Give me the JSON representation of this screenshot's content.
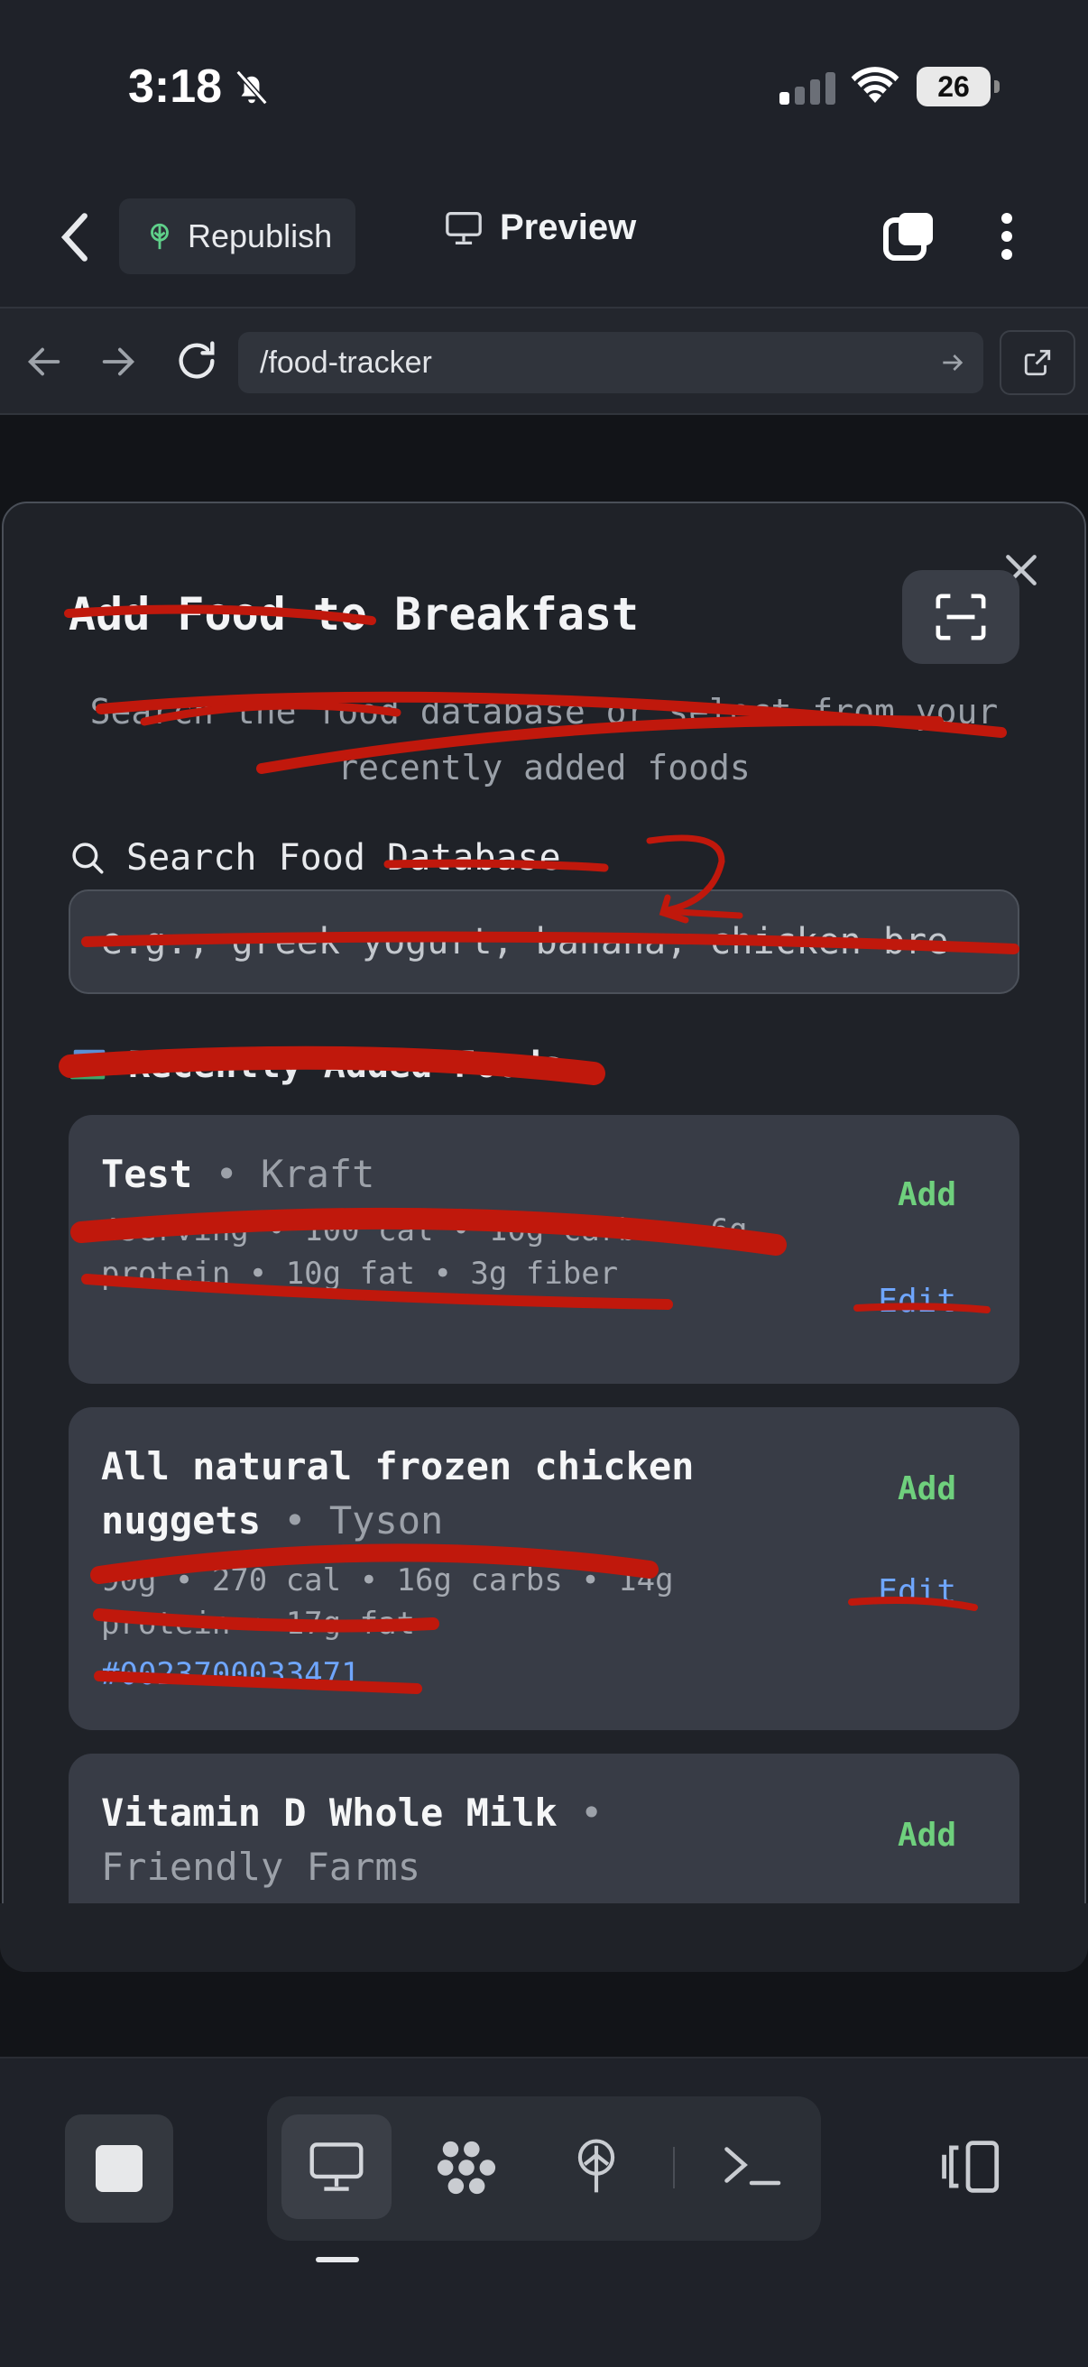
{
  "status_bar": {
    "time": "3:18",
    "battery": "26"
  },
  "toolbar": {
    "republish_label": "Republish",
    "preview_label": "Preview"
  },
  "address_bar": {
    "url": "/food-tracker"
  },
  "modal": {
    "title": "Add Food to Breakfast",
    "subtitle": "Search the food database or select from your recently added foods",
    "search_label": "Search Food Database",
    "search_placeholder": "e.g., greek yogurt, banana, chicken bre",
    "recent_label": "Recently Added Foods",
    "foods": [
      {
        "name": "Test",
        "brand": "Kraft",
        "macros": "4serving • 100 cal • 10g carbs • 6g protein • 10g fat • 3g fiber",
        "add_label": "Add",
        "edit_label": "Edit"
      },
      {
        "name": "All natural frozen chicken nuggets",
        "brand": "Tyson",
        "macros": "90g • 270 cal • 16g carbs • 14g protein • 17g fat",
        "barcode": "#0023700033471",
        "add_label": "Add",
        "edit_label": "Edit"
      },
      {
        "name": "Vitamin D Whole Milk",
        "brand": "Friendly Farms",
        "add_label": "Add"
      }
    ]
  },
  "colors": {
    "accent_green": "#6fd07d",
    "link_blue": "#6fa6ff",
    "annotation_red": "#c0180c"
  }
}
